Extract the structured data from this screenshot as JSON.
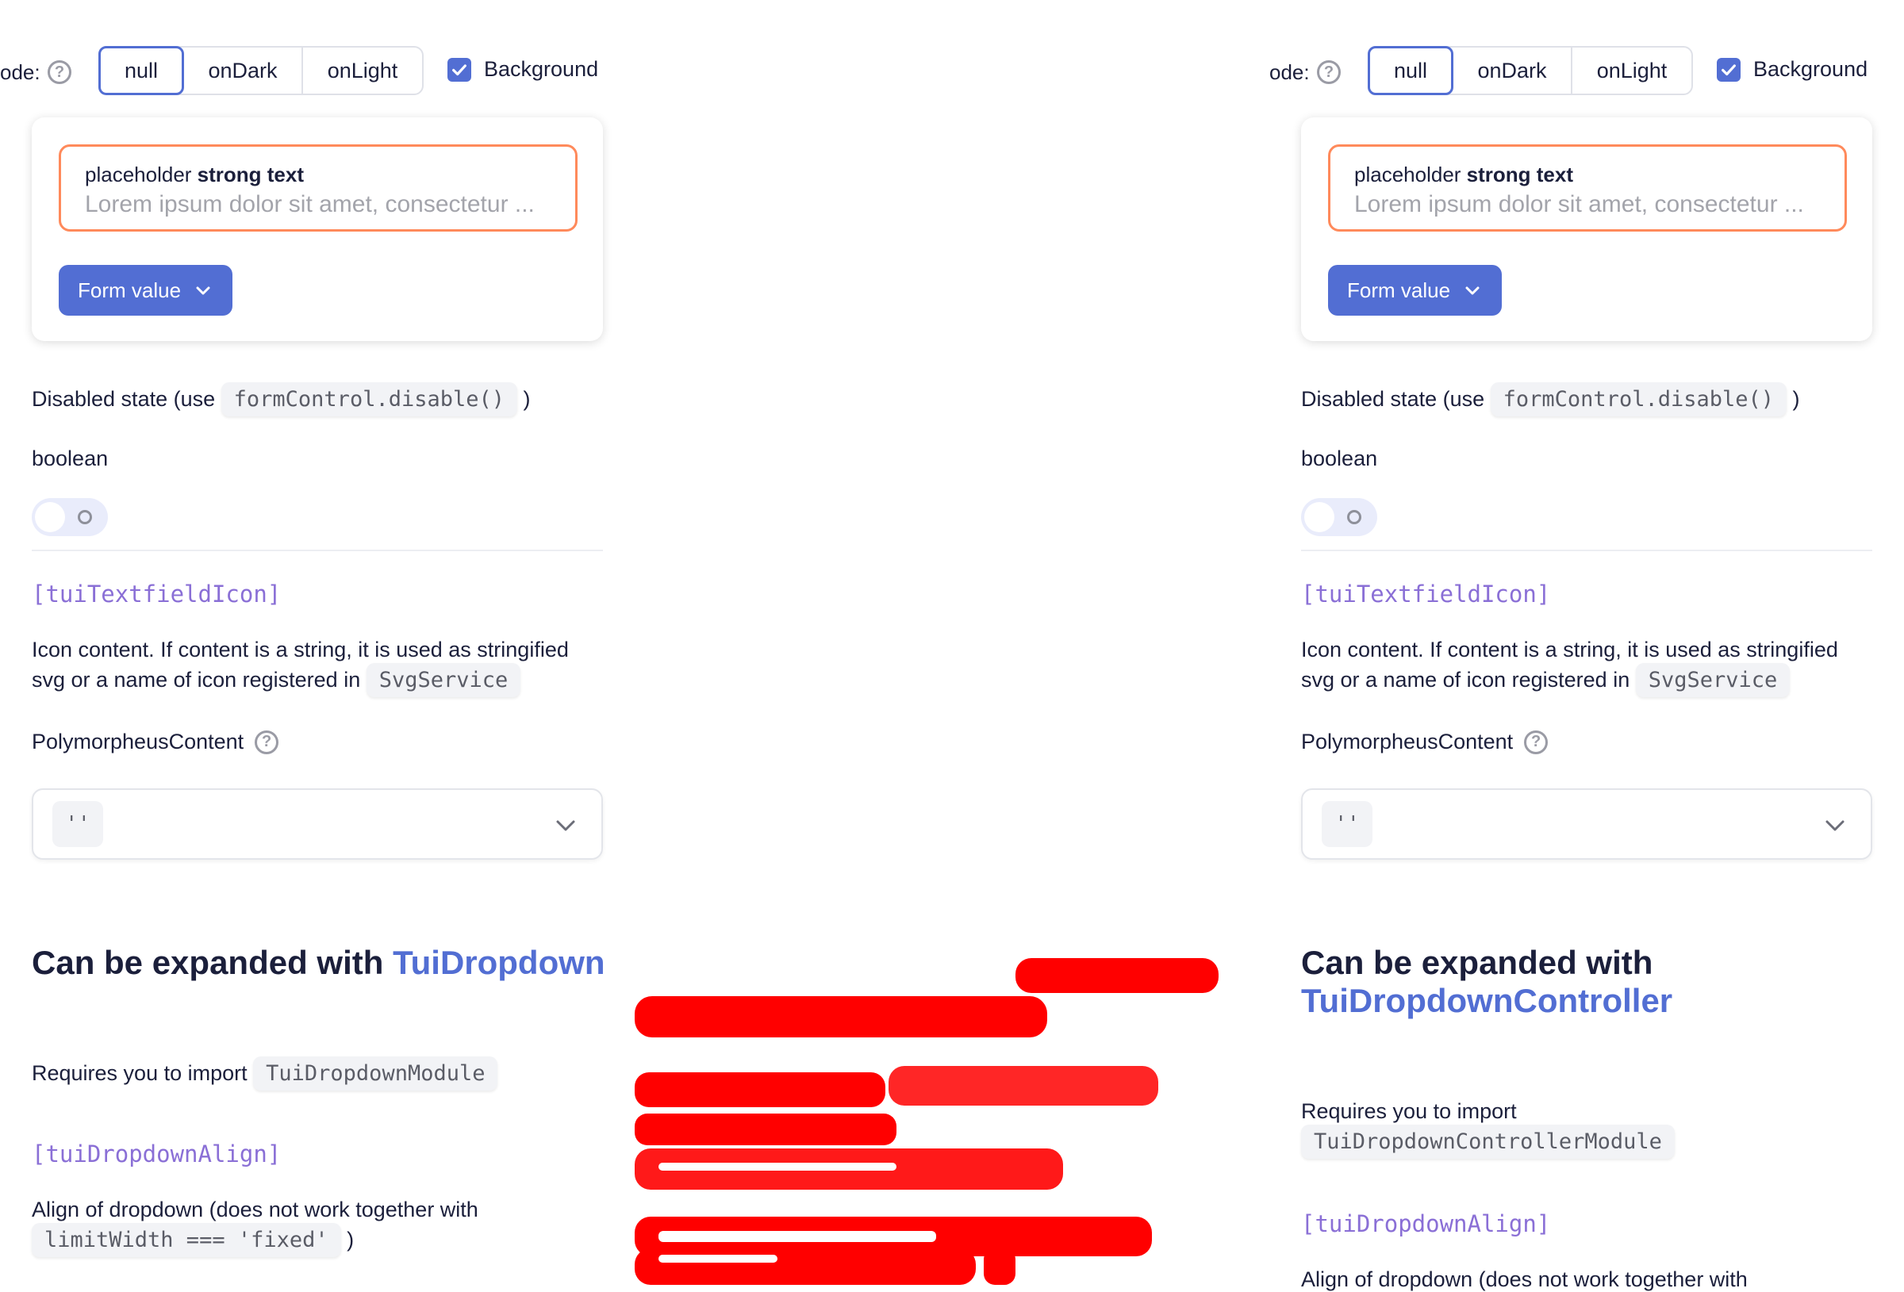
{
  "panels": [
    {
      "mode_label": "ode:",
      "modes": [
        "null",
        "onDark",
        "onLight"
      ],
      "background_label": "Background",
      "textfield": {
        "label_prefix": "placeholder ",
        "label_strong": "strong text",
        "placeholder": "Lorem ipsum dolor sit amet, consectetur ..."
      },
      "form_value_button": "Form value",
      "disabled_text": "Disabled state (use",
      "disabled_code": "formControl.disable()",
      "disabled_close": ")",
      "boolean_label": "boolean",
      "icon_prop": "[tuiTextfieldIcon]",
      "icon_desc_line1": "Icon content. If content is a string, it is used as stringified",
      "icon_desc_line2": "svg or a name of icon registered in",
      "icon_desc_code": "SvgService",
      "polymorpheus_label": "PolymorpheusContent",
      "select_value": "''",
      "heading_prefix": "Can be expanded with ",
      "heading_link": "TuiDropdown",
      "requires_text": "Requires you to import",
      "requires_code": "TuiDropdownModule",
      "align_prop": "[tuiDropdownAlign]",
      "align_desc": "Align of dropdown (does not work together with",
      "align_code": "limitWidth === 'fixed'",
      "align_close": ")"
    },
    {
      "mode_label": "ode:",
      "modes": [
        "null",
        "onDark",
        "onLight"
      ],
      "background_label": "Background",
      "textfield": {
        "label_prefix": "placeholder ",
        "label_strong": "strong text",
        "placeholder": "Lorem ipsum dolor sit amet, consectetur ..."
      },
      "form_value_button": "Form value",
      "disabled_text": "Disabled state (use",
      "disabled_code": "formControl.disable()",
      "disabled_close": ")",
      "boolean_label": "boolean",
      "icon_prop": "[tuiTextfieldIcon]",
      "icon_desc_line1": "Icon content. If content is a string, it is used as stringified",
      "icon_desc_line2": "svg or a name of icon registered in",
      "icon_desc_code": "SvgService",
      "polymorpheus_label": "PolymorpheusContent",
      "select_value": "''",
      "heading_prefix": "Can be expanded with",
      "heading_link": "TuiDropdownController",
      "requires_text": "Requires you to import",
      "requires_code": "TuiDropdownControllerModule",
      "align_prop": "[tuiDropdownAlign]",
      "align_desc": "Align of dropdown (does not work together with"
    }
  ],
  "colors": {
    "accent": "#526ed3",
    "textfield_border": "#ff8a5b",
    "prop_name": "#8a6fd6",
    "redaction": "#ff0000"
  },
  "icons": [
    "help-circle-icon",
    "checkbox-check-icon",
    "chevron-down-icon"
  ]
}
